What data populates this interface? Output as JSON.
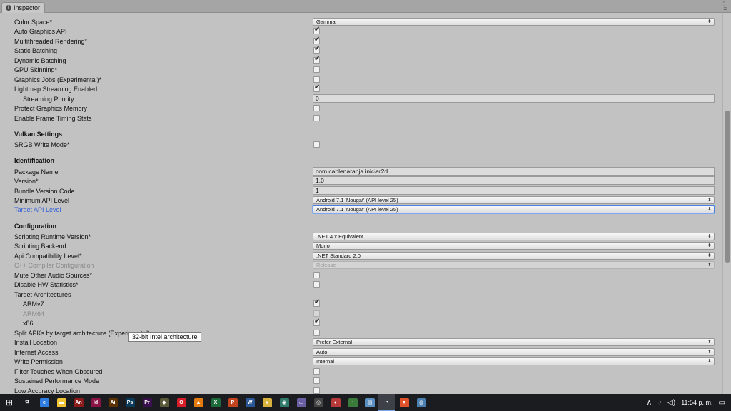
{
  "window": {
    "tab_title": "Inspector",
    "tab_icon": "i",
    "controls": [
      "⋮",
      "≡"
    ]
  },
  "rows": [
    {
      "id": "color-space",
      "type": "dropdown",
      "label": "Color Space*",
      "value": "Gamma"
    },
    {
      "id": "auto-graphics-api",
      "type": "checkbox",
      "label": "Auto Graphics API",
      "checked": true
    },
    {
      "id": "multithreaded-rendering",
      "type": "checkbox",
      "label": "Multithreaded Rendering*",
      "checked": true
    },
    {
      "id": "static-batching",
      "type": "checkbox",
      "label": "Static Batching",
      "checked": true
    },
    {
      "id": "dynamic-batching",
      "type": "checkbox",
      "label": "Dynamic Batching",
      "checked": true
    },
    {
      "id": "gpu-skinning",
      "type": "checkbox",
      "label": "GPU Skinning*",
      "checked": false
    },
    {
      "id": "graphics-jobs",
      "type": "checkbox",
      "label": "Graphics Jobs (Experimental)*",
      "checked": false
    },
    {
      "id": "lightmap-streaming",
      "type": "checkbox",
      "label": "Lightmap Streaming Enabled",
      "checked": true
    },
    {
      "id": "streaming-priority",
      "type": "text",
      "label": "Streaming Priority",
      "value": "0",
      "indent": true
    },
    {
      "id": "protect-graphics-memory",
      "type": "checkbox",
      "label": "Protect Graphics Memory",
      "checked": false
    },
    {
      "id": "frame-timing-stats",
      "type": "checkbox",
      "label": "Enable Frame Timing Stats",
      "checked": false
    },
    {
      "id": "vulkan-header",
      "type": "header",
      "label": "Vulkan Settings"
    },
    {
      "id": "srgb-write-mode",
      "type": "checkbox",
      "label": "SRGB Write Mode*",
      "checked": false
    },
    {
      "id": "identification-header",
      "type": "header",
      "label": "Identification"
    },
    {
      "id": "package-name",
      "type": "text",
      "label": "Package Name",
      "value": "com.cablenaranja.iniciar2d"
    },
    {
      "id": "version",
      "type": "text",
      "label": "Version*",
      "value": "1.0"
    },
    {
      "id": "bundle-version-code",
      "type": "text",
      "label": "Bundle Version Code",
      "value": "1"
    },
    {
      "id": "minimum-api-level",
      "type": "dropdown",
      "label": "Minimum API Level",
      "value": "Android 7.1 'Nougat' (API level 25)"
    },
    {
      "id": "target-api-level",
      "type": "dropdown",
      "label": "Target API Level",
      "value": "Android 7.1 'Nougat' (API level 25)",
      "focused": true
    },
    {
      "id": "configuration-header",
      "type": "header",
      "label": "Configuration"
    },
    {
      "id": "scripting-runtime-version",
      "type": "dropdown",
      "label": "Scripting Runtime Version*",
      "value": ".NET 4.x Equivalent"
    },
    {
      "id": "scripting-backend",
      "type": "dropdown",
      "label": "Scripting Backend",
      "value": "Mono"
    },
    {
      "id": "api-compatibility-level",
      "type": "dropdown",
      "label": "Api Compatibility Level*",
      "value": ".NET Standard 2.0"
    },
    {
      "id": "cpp-compiler-configuration",
      "type": "dropdown",
      "label": "C++ Compiler Configuration",
      "value": "Release",
      "disabled": true
    },
    {
      "id": "mute-other-audio",
      "type": "checkbox",
      "label": "Mute Other Audio Sources*",
      "checked": false
    },
    {
      "id": "disable-hw-statistics",
      "type": "checkbox",
      "label": "Disable HW Statistics*",
      "checked": false
    },
    {
      "id": "target-architectures",
      "type": "label",
      "label": "Target Architectures"
    },
    {
      "id": "armv7",
      "type": "checkbox",
      "label": "ARMv7",
      "checked": true,
      "indent": true
    },
    {
      "id": "arm64",
      "type": "checkbox",
      "label": "ARM64",
      "checked": false,
      "indent": true,
      "disabled": true
    },
    {
      "id": "x86",
      "type": "checkbox",
      "label": "x86",
      "checked": true,
      "indent": true
    },
    {
      "id": "split-apks",
      "type": "checkbox",
      "label": "Split APKs by target architecture (Experimental)",
      "checked": false
    },
    {
      "id": "install-location",
      "type": "dropdown",
      "label": "Install Location",
      "value": "Prefer External"
    },
    {
      "id": "internet-access",
      "type": "dropdown",
      "label": "Internet Access",
      "value": "Auto"
    },
    {
      "id": "write-permission",
      "type": "dropdown",
      "label": "Write Permission",
      "value": "Internal"
    },
    {
      "id": "filter-touches",
      "type": "checkbox",
      "label": "Filter Touches When Obscured",
      "checked": false
    },
    {
      "id": "sustained-performance",
      "type": "checkbox",
      "label": "Sustained Performance Mode",
      "checked": false
    },
    {
      "id": "low-accuracy-location",
      "type": "checkbox",
      "label": "Low Accuracy Location",
      "checked": false
    }
  ],
  "tooltip": {
    "text": "32-bit Intel architecture"
  },
  "taskbar": {
    "icons": [
      {
        "name": "task-view-icon",
        "glyph": "⧉",
        "color": "#1a1c20"
      },
      {
        "name": "edge-icon",
        "glyph": "e",
        "color": "#2f7de1"
      },
      {
        "name": "file-explorer-icon",
        "glyph": "▬",
        "color": "#f1c232"
      },
      {
        "name": "animate-icon",
        "glyph": "An",
        "color": "#8b1a1a"
      },
      {
        "name": "indesign-icon",
        "glyph": "Id",
        "color": "#8a1445"
      },
      {
        "name": "illustrator-icon",
        "glyph": "Ai",
        "color": "#5b3200"
      },
      {
        "name": "photoshop-icon",
        "glyph": "Ps",
        "color": "#0b3b5a"
      },
      {
        "name": "premiere-icon",
        "glyph": "Pr",
        "color": "#3a0f4d"
      },
      {
        "name": "gimp-icon",
        "glyph": "◆",
        "color": "#5a5a3a"
      },
      {
        "name": "opera-icon",
        "glyph": "O",
        "color": "#d61d28"
      },
      {
        "name": "vlc-icon",
        "glyph": "▲",
        "color": "#e57c12"
      },
      {
        "name": "excel-icon",
        "glyph": "X",
        "color": "#1d6b3a"
      },
      {
        "name": "powerpoint-icon",
        "glyph": "P",
        "color": "#c2451f"
      },
      {
        "name": "word-icon",
        "glyph": "W",
        "color": "#2b5797"
      },
      {
        "name": "app-yellow-icon",
        "glyph": "●",
        "color": "#d8b23c"
      },
      {
        "name": "app-green-icon",
        "glyph": "◉",
        "color": "#2f7a6b"
      },
      {
        "name": "app-pill-icon",
        "glyph": "▭",
        "color": "#6b5fa3"
      },
      {
        "name": "unity-icon",
        "glyph": "◎",
        "color": "#444"
      },
      {
        "name": "app-red-icon",
        "glyph": "◐",
        "color": "#b73a3a"
      },
      {
        "name": "app-circle-icon",
        "glyph": "◔",
        "color": "#3a7a3a"
      },
      {
        "name": "notes-icon",
        "glyph": "▤",
        "color": "#5a8fbf"
      },
      {
        "name": "unity-editor-icon",
        "glyph": "◂",
        "color": "#3d4047",
        "active": true
      },
      {
        "name": "brave-icon",
        "glyph": "▼",
        "color": "#e0522b"
      },
      {
        "name": "app-last-icon",
        "glyph": "◍",
        "color": "#4a7fb0"
      }
    ],
    "tray": {
      "clock": "11:54 p. m.",
      "chevron": "∧",
      "wifi": "◔",
      "volume": "◁)",
      "notifications": "▭"
    }
  }
}
